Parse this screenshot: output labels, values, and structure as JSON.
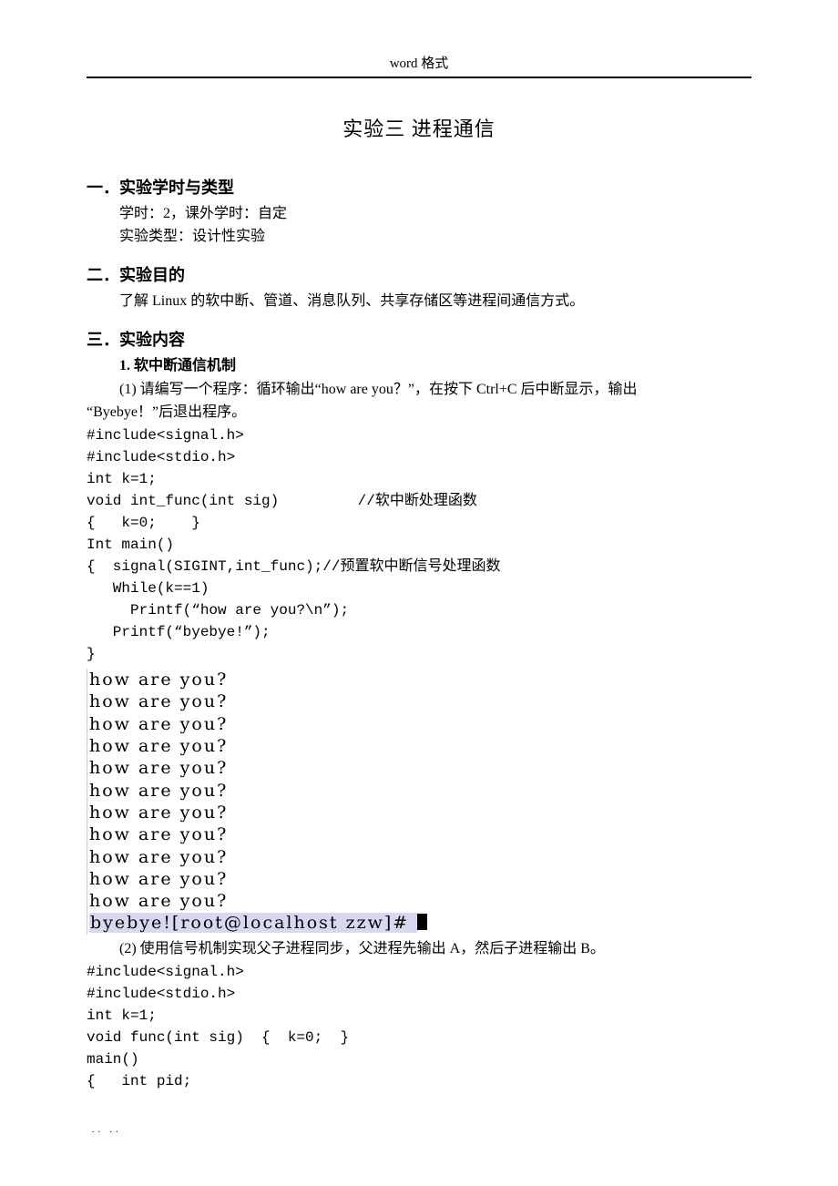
{
  "header": {
    "label": "word 格式"
  },
  "title": "实验三 进程通信",
  "section1": {
    "head": "一．实验学时与类型",
    "line1": "学时：2，课外学时：自定",
    "line2": "实验类型：设计性实验"
  },
  "section2": {
    "head": "二．实验目的",
    "line1": "了解 Linux 的软中断、管道、消息队列、共享存储区等进程间通信方式。"
  },
  "section3": {
    "head": "三．实验内容",
    "sub1": "1. 软中断通信机制",
    "q1a": "(1)  请编写一个程序：循环输出“how are you？”，在按下 Ctrl+C 后中断显示，输出",
    "q1b": "“Byebye！”后退出程序。",
    "code1": "#include<signal.h>\n#include<stdio.h>\nint k=1;\nvoid int_func(int sig)         //软中断处理函数\n{   k=0;    }\nInt main()\n{  signal(SIGINT,int_func);//预置软中断信号处理函数\n   While(k==1)\n     Printf(“how are you?\\n”);\n   Printf(“byebye!”);\n}",
    "terminal": {
      "lines": [
        "how are you?",
        "how are you?",
        "how are you?",
        "how are you?",
        "how are you?",
        "how are you?",
        "how are you?",
        "how are you?",
        "how are you?",
        "how are you?",
        "how are you?"
      ],
      "last": "byebye![root@localhost zzw]# "
    },
    "q2": "(2) 使用信号机制实现父子进程同步，父进程先输出 A，然后子进程输出 B。",
    "code2": "#include<signal.h>\n#include<stdio.h>\nint k=1;\nvoid func(int sig)  {  k=0;  }\nmain()\n{   int pid;"
  },
  "footer": ".. .."
}
